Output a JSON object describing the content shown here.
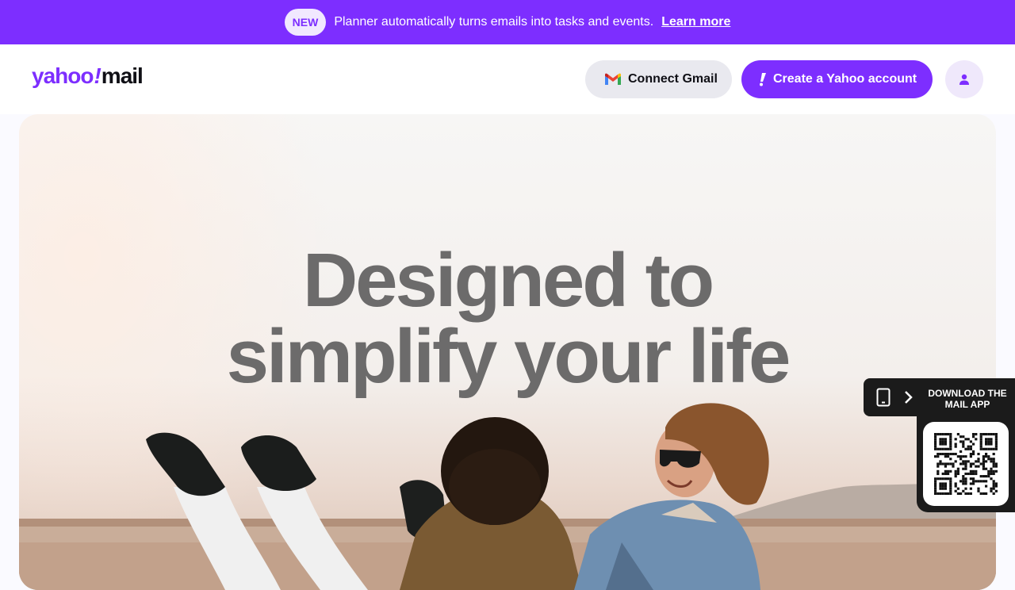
{
  "banner": {
    "badge": "NEW",
    "text": "Planner automatically turns emails into tasks and events.",
    "link": "Learn more"
  },
  "header": {
    "logo": {
      "part1": "yahoo",
      "part2": "!",
      "part3": "mail"
    },
    "connect_gmail": "Connect Gmail",
    "create_account": "Create a Yahoo account",
    "user_icon": "user-icon"
  },
  "hero": {
    "line1": "Designed to",
    "line2": "simplify your life"
  },
  "download": {
    "line1": "DOWNLOAD THE",
    "line2": "MAIL APP",
    "phone_icon": "phone-icon",
    "chevron_icon": "chevron-right-icon"
  },
  "colors": {
    "brand": "#7d2eff",
    "dark": "#1b1b1b",
    "headline": "#6c6b6b"
  }
}
